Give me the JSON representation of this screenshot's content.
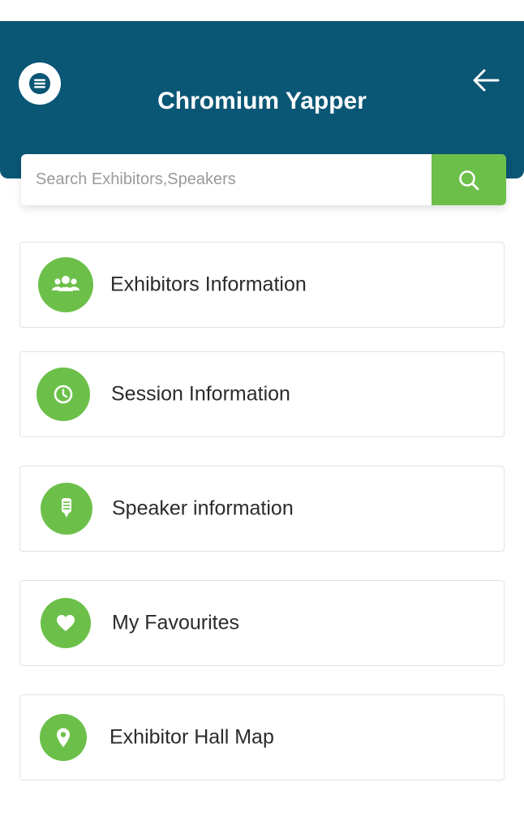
{
  "header": {
    "title": "Chromium Yapper",
    "menu_icon": "hamburger-menu-icon",
    "back_icon": "arrow-left-icon",
    "background_color": "#0a5675"
  },
  "search": {
    "placeholder": "Search Exhibitors,Speakers",
    "value": "",
    "button_icon": "search-icon",
    "button_color": "#6cc04a"
  },
  "menu": {
    "accent_color": "#6cc04a",
    "items": [
      {
        "label": "Exhibitors Information",
        "icon": "users-group-icon"
      },
      {
        "label": "Session Information",
        "icon": "clock-icon"
      },
      {
        "label": "Speaker information",
        "icon": "microphone-icon"
      },
      {
        "label": "My Favourites",
        "icon": "heart-icon"
      },
      {
        "label": "Exhibitor Hall Map",
        "icon": "map-pin-icon"
      }
    ]
  }
}
